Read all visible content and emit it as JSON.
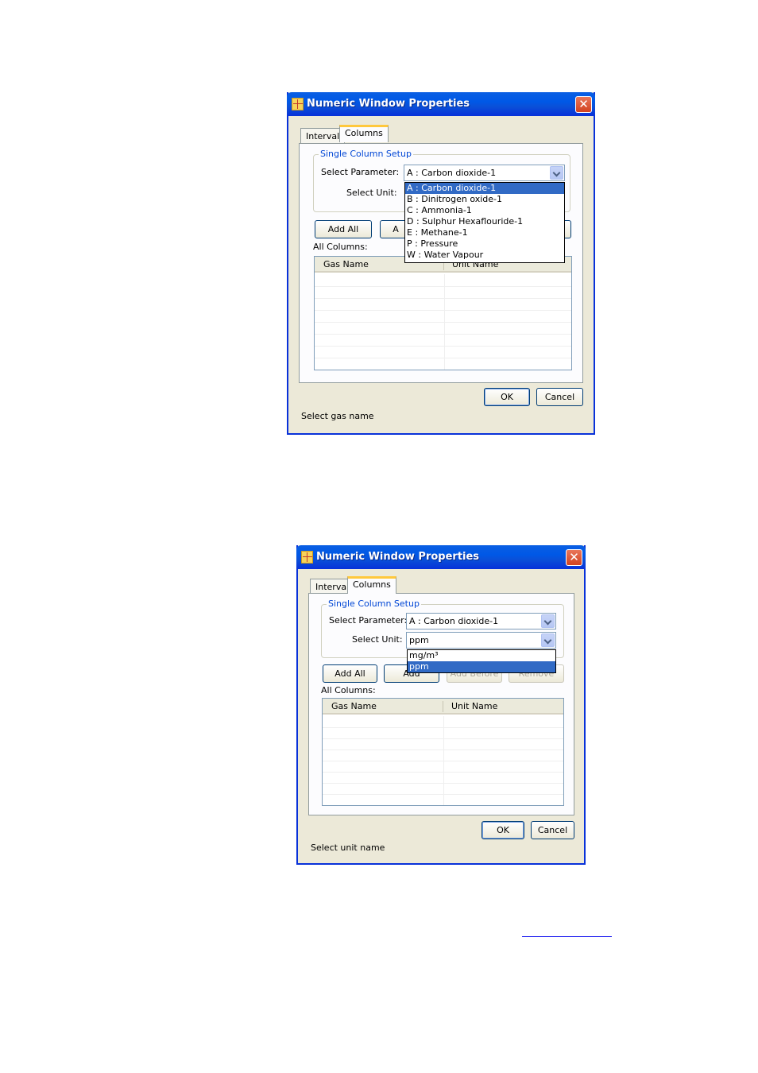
{
  "dialog1": {
    "title": "Numeric Window Properties",
    "close": "✕",
    "tabs": [
      "Interval",
      "Columns"
    ],
    "group_title": "Single Column Setup",
    "param_label": "Select Parameter:",
    "param_value": "A : Carbon dioxide-1",
    "unit_label": "Select Unit:",
    "param_options": [
      "A : Carbon dioxide-1",
      "B : Dinitrogen oxide-1",
      "C : Ammonia-1",
      "D : Sulphur Hexaflouride-1",
      "E : Methane-1",
      "P : Pressure",
      "W : Water Vapour"
    ],
    "buttons": {
      "add_all": "Add All",
      "add_partial": "A"
    },
    "all_columns_label": "All Columns:",
    "columns": {
      "gas": "Gas Name",
      "unit": "Unit Name"
    },
    "ok": "OK",
    "cancel": "Cancel",
    "status": "Select gas name"
  },
  "dialog2": {
    "title": "Numeric Window Properties",
    "close": "✕",
    "tabs": [
      "Interval",
      "Columns"
    ],
    "group_title": "Single Column Setup",
    "param_label": "Select Parameter:",
    "param_value": "A : Carbon dioxide-1",
    "unit_label": "Select Unit:",
    "unit_value": "ppm",
    "unit_options": [
      "mg/m³",
      "ppm"
    ],
    "buttons": {
      "add_all": "Add All",
      "add": "Add",
      "add_before": "Add Before",
      "remove": "Remove"
    },
    "all_columns_label": "All Columns:",
    "columns": {
      "gas": "Gas Name",
      "unit": "Unit Name"
    },
    "ok": "OK",
    "cancel": "Cancel",
    "status": "Select unit name"
  }
}
